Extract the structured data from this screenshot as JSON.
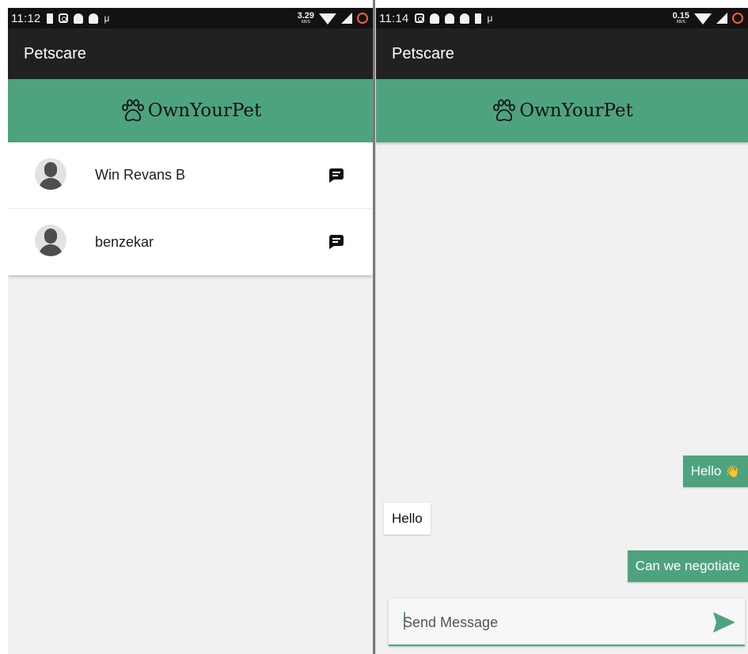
{
  "colors": {
    "accent": "#4ea37f",
    "appbar": "#212121",
    "statusbar": "#121212",
    "background": "#f1f1f1"
  },
  "left": {
    "status": {
      "time": "11:12",
      "speed_value": "3.29",
      "speed_unit": "KB/S"
    },
    "app_title": "Petscare",
    "brand": "OwnYourPet",
    "chats": [
      {
        "name": "Win Revans B",
        "icon": "chat-bubble-icon"
      },
      {
        "name": "benzekar",
        "icon": "chat-bubble-icon"
      }
    ]
  },
  "right": {
    "status": {
      "time": "11:14",
      "speed_value": "0.15",
      "speed_unit": "KB/S"
    },
    "app_title": "Petscare",
    "brand": "OwnYourPet",
    "messages": [
      {
        "text": "Hello",
        "emoji": "👋",
        "direction": "outgoing"
      },
      {
        "text": "Hello",
        "direction": "incoming"
      },
      {
        "text": "Can we negotiate",
        "direction": "outgoing"
      }
    ],
    "composer": {
      "placeholder": "Send Message",
      "value": ""
    },
    "icons": {
      "send": "send-icon",
      "paw": "paw-icon"
    }
  }
}
